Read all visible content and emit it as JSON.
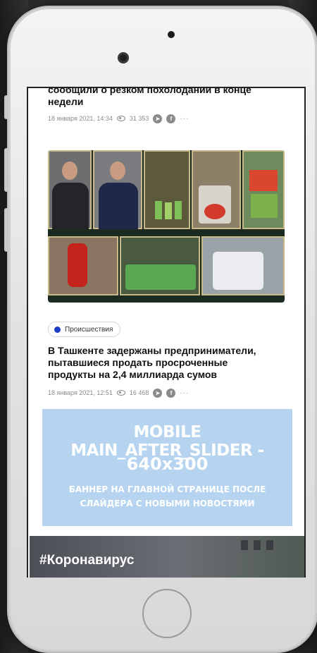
{
  "article_top": {
    "title_line1": "сообщили о резком похолодании в конце",
    "title_line2": "недели",
    "date": "18 января 2021, 14:34",
    "views": "31 353",
    "share_more": "···"
  },
  "article_main": {
    "category": "Происшествия",
    "title_line1": "В Ташкенте задержаны предприниматели,",
    "title_line2": "пытавшиеся продать просроченные",
    "title_line3": "продукты на 2,4 миллиарда сумов",
    "date": "18 января 2021, 12:51",
    "views": "16 468",
    "share_more": "···"
  },
  "banner": {
    "line1": "MOBILE MAIN_AFTER_SLIDER -",
    "line2": "640x300",
    "line3": "БАННЕР НА ГЛАВНОЙ СТРАНИЦЕ ПОСЛЕ",
    "line4": "СЛАЙДЕРА С НОВЫМИ НОВОСТЯМИ"
  },
  "section": {
    "hashtag": "#Коронавирус"
  },
  "icons": {
    "views": "eye-icon",
    "share1": "telegram-icon",
    "share2": "facebook-icon",
    "more": "more-icon"
  },
  "colors": {
    "banner_bg": "#b6d4f0",
    "category_dot": "#1d3bc4"
  }
}
